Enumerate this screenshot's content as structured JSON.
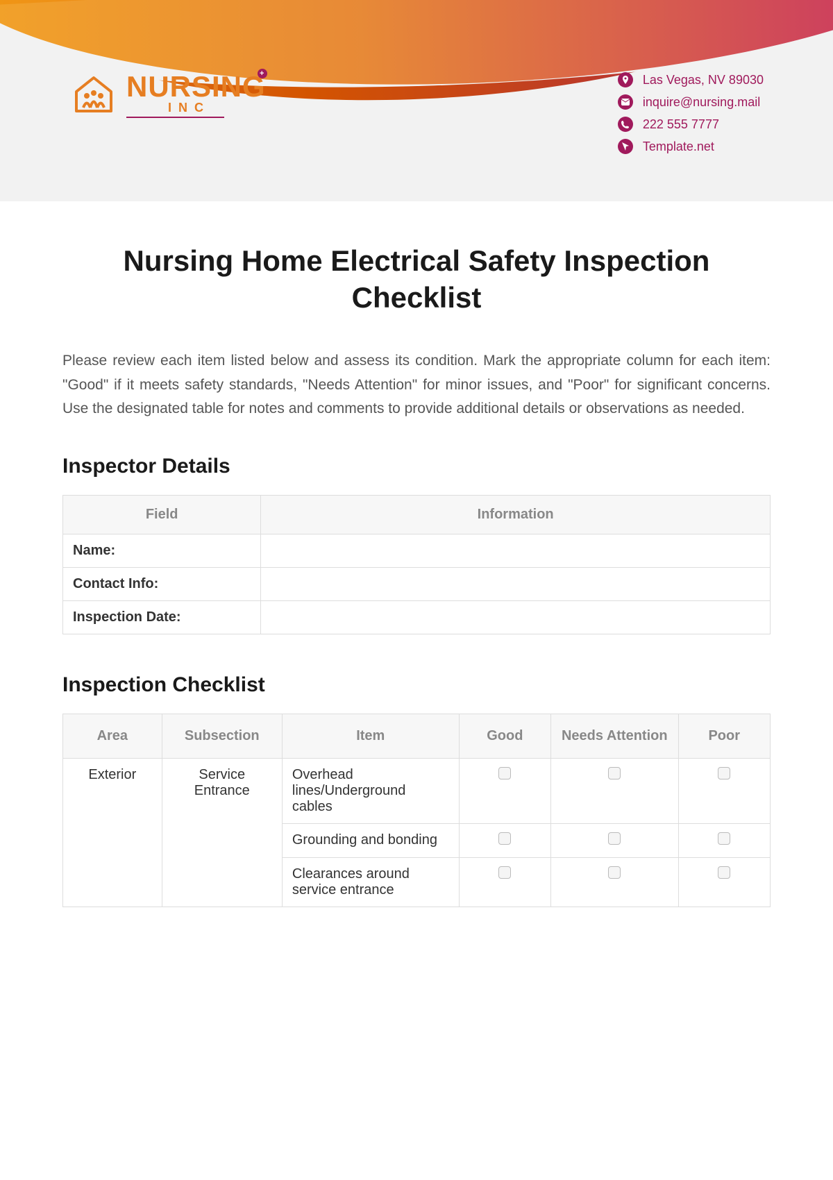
{
  "header": {
    "logo_main": "NURSING",
    "logo_sub": "INC",
    "contacts": [
      {
        "icon": "location-icon",
        "glyph": "⬤",
        "text": "Las Vegas, NV 89030"
      },
      {
        "icon": "email-icon",
        "glyph": "✉",
        "text": "inquire@nursing.mail"
      },
      {
        "icon": "phone-icon",
        "glyph": "✆",
        "text": "222 555 7777"
      },
      {
        "icon": "web-icon",
        "glyph": "➤",
        "text": "Template.net"
      }
    ]
  },
  "title": "Nursing Home Electrical Safety Inspection Checklist",
  "intro": "Please review each item listed below and assess its condition. Mark the appropriate column for each item: \"Good\" if it meets safety standards, \"Needs Attention\" for minor issues, and \"Poor\" for significant concerns. Use the designated table for notes and comments to provide additional details or observations as needed.",
  "sections": {
    "inspector_heading": "Inspector Details",
    "checklist_heading": "Inspection Checklist"
  },
  "inspector_table": {
    "headers": [
      "Field",
      "Information"
    ],
    "rows": [
      {
        "field": "Name:",
        "info": ""
      },
      {
        "field": "Contact Info:",
        "info": ""
      },
      {
        "field": "Inspection Date:",
        "info": ""
      }
    ]
  },
  "checklist_table": {
    "headers": [
      "Area",
      "Subsection",
      "Item",
      "Good",
      "Needs Attention",
      "Poor"
    ],
    "rows": [
      {
        "area": "Exterior",
        "subsection": "Service Entrance",
        "item": "Overhead lines/Underground cables"
      },
      {
        "area": "",
        "subsection": "",
        "item": "Grounding and bonding"
      },
      {
        "area": "",
        "subsection": "",
        "item": "Clearances around service entrance"
      }
    ]
  }
}
